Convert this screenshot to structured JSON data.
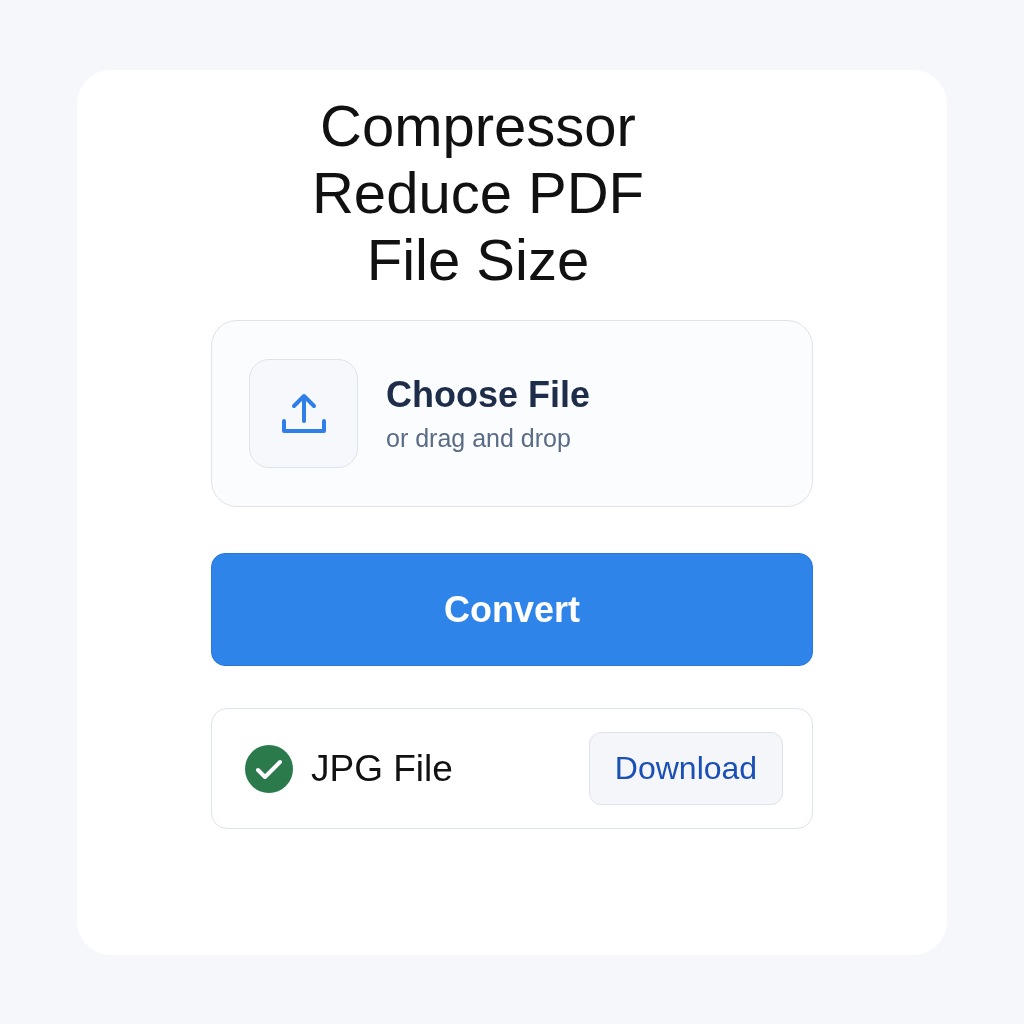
{
  "title_lines": [
    "Compressor",
    "Reduce PDF",
    "File Size"
  ],
  "upload": {
    "label": "Choose File",
    "hint": "or drag and drop"
  },
  "convert_button": "Convert",
  "result": {
    "file_name": "JPG File",
    "download_button": "Download"
  }
}
